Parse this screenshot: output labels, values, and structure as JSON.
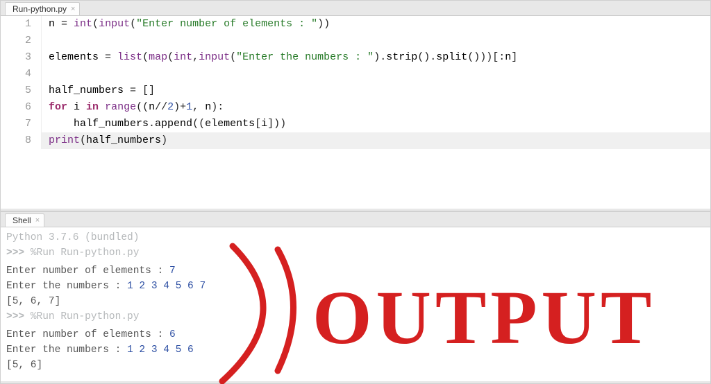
{
  "editor": {
    "tab_label": "Run-python.py",
    "lines": [
      {
        "num": "1",
        "hl": false,
        "tokens": [
          {
            "cls": "tok-name",
            "t": "n "
          },
          {
            "cls": "tok-op",
            "t": "= "
          },
          {
            "cls": "tok-builtin",
            "t": "int"
          },
          {
            "cls": "tok-op",
            "t": "("
          },
          {
            "cls": "tok-builtin",
            "t": "input"
          },
          {
            "cls": "tok-op",
            "t": "("
          },
          {
            "cls": "tok-str",
            "t": "\"Enter number of elements : \""
          },
          {
            "cls": "tok-op",
            "t": "))"
          }
        ]
      },
      {
        "num": "2",
        "hl": false,
        "tokens": []
      },
      {
        "num": "3",
        "hl": false,
        "tokens": [
          {
            "cls": "tok-name",
            "t": "elements "
          },
          {
            "cls": "tok-op",
            "t": "= "
          },
          {
            "cls": "tok-builtin",
            "t": "list"
          },
          {
            "cls": "tok-op",
            "t": "("
          },
          {
            "cls": "tok-builtin",
            "t": "map"
          },
          {
            "cls": "tok-op",
            "t": "("
          },
          {
            "cls": "tok-builtin",
            "t": "int"
          },
          {
            "cls": "tok-op",
            "t": ","
          },
          {
            "cls": "tok-builtin",
            "t": "input"
          },
          {
            "cls": "tok-op",
            "t": "("
          },
          {
            "cls": "tok-str",
            "t": "\"Enter the numbers : \""
          },
          {
            "cls": "tok-op",
            "t": ")."
          },
          {
            "cls": "tok-name",
            "t": "strip"
          },
          {
            "cls": "tok-op",
            "t": "()."
          },
          {
            "cls": "tok-name",
            "t": "split"
          },
          {
            "cls": "tok-op",
            "t": "()))[:"
          },
          {
            "cls": "tok-name",
            "t": "n"
          },
          {
            "cls": "tok-op",
            "t": "]"
          }
        ]
      },
      {
        "num": "4",
        "hl": false,
        "tokens": []
      },
      {
        "num": "5",
        "hl": false,
        "tokens": [
          {
            "cls": "tok-name",
            "t": "half_numbers "
          },
          {
            "cls": "tok-op",
            "t": "= []"
          }
        ]
      },
      {
        "num": "6",
        "hl": false,
        "tokens": [
          {
            "cls": "tok-kw",
            "t": "for"
          },
          {
            "cls": "tok-name",
            "t": " i "
          },
          {
            "cls": "tok-kw",
            "t": "in"
          },
          {
            "cls": "tok-name",
            "t": " "
          },
          {
            "cls": "tok-builtin",
            "t": "range"
          },
          {
            "cls": "tok-op",
            "t": "(("
          },
          {
            "cls": "tok-name",
            "t": "n"
          },
          {
            "cls": "tok-op",
            "t": "//"
          },
          {
            "cls": "tok-num",
            "t": "2"
          },
          {
            "cls": "tok-op",
            "t": ")+"
          },
          {
            "cls": "tok-num",
            "t": "1"
          },
          {
            "cls": "tok-op",
            "t": ", "
          },
          {
            "cls": "tok-name",
            "t": "n"
          },
          {
            "cls": "tok-op",
            "t": "):"
          }
        ]
      },
      {
        "num": "7",
        "hl": false,
        "tokens": [
          {
            "cls": "tok-name",
            "t": "    half_numbers"
          },
          {
            "cls": "tok-op",
            "t": "."
          },
          {
            "cls": "tok-name",
            "t": "append"
          },
          {
            "cls": "tok-op",
            "t": "(("
          },
          {
            "cls": "tok-name",
            "t": "elements"
          },
          {
            "cls": "tok-op",
            "t": "["
          },
          {
            "cls": "tok-name",
            "t": "i"
          },
          {
            "cls": "tok-op",
            "t": "]))"
          }
        ]
      },
      {
        "num": "8",
        "hl": true,
        "tokens": [
          {
            "cls": "tok-builtin",
            "t": "print"
          },
          {
            "cls": "tok-op",
            "t": "("
          },
          {
            "cls": "tok-name",
            "t": "half_numbers"
          },
          {
            "cls": "tok-op",
            "t": ")"
          }
        ]
      }
    ]
  },
  "shell": {
    "tab_label": "Shell",
    "header": "Python 3.7.6 (bundled)",
    "blocks": [
      {
        "prompt": ">>>",
        "cmd": "%Run Run-python.py",
        "lines": [
          {
            "label": "  Enter number of elements : ",
            "val": "7"
          },
          {
            "label": "  Enter the numbers : ",
            "val": "1 2 3 4 5 6 7"
          },
          {
            "label": "  [5, 6, 7]",
            "val": ""
          }
        ]
      },
      {
        "prompt": ">>>",
        "cmd": "%Run Run-python.py",
        "lines": [
          {
            "label": "  Enter number of elements : ",
            "val": "6"
          },
          {
            "label": "  Enter the numbers : ",
            "val": "1 2 3 4 5 6"
          },
          {
            "label": "  [5, 6]",
            "val": ""
          }
        ]
      }
    ]
  },
  "annotation": {
    "text": "OUTPUT",
    "color": "#d52020"
  }
}
